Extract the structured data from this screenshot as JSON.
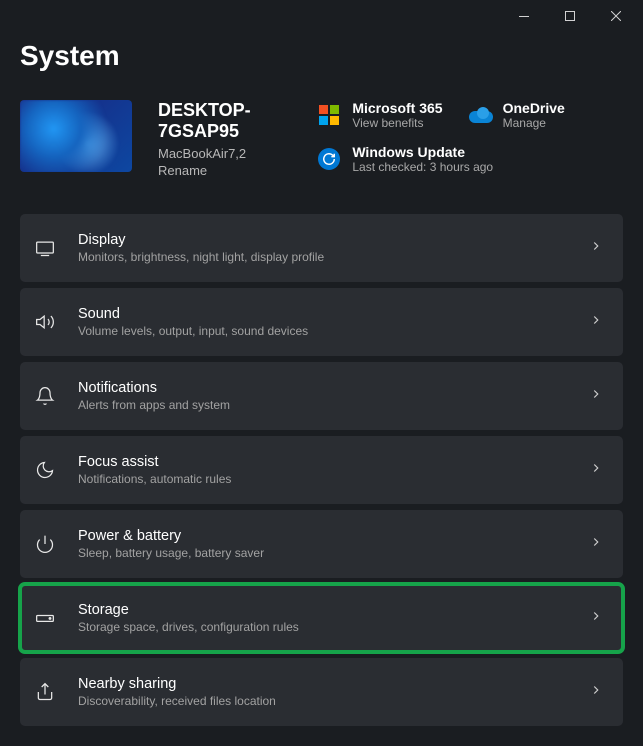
{
  "page": {
    "title": "System"
  },
  "pc": {
    "name": "DESKTOP-7GSAP95",
    "model": "MacBookAir7,2",
    "rename": "Rename"
  },
  "tiles": {
    "ms365": {
      "title": "Microsoft 365",
      "sub": "View benefits"
    },
    "onedrive": {
      "title": "OneDrive",
      "sub": "Manage"
    },
    "update": {
      "title": "Windows Update",
      "sub": "Last checked: 3 hours ago"
    }
  },
  "settings": [
    {
      "id": "display",
      "title": "Display",
      "sub": "Monitors, brightness, night light, display profile"
    },
    {
      "id": "sound",
      "title": "Sound",
      "sub": "Volume levels, output, input, sound devices"
    },
    {
      "id": "notifications",
      "title": "Notifications",
      "sub": "Alerts from apps and system"
    },
    {
      "id": "focus-assist",
      "title": "Focus assist",
      "sub": "Notifications, automatic rules"
    },
    {
      "id": "power-battery",
      "title": "Power & battery",
      "sub": "Sleep, battery usage, battery saver"
    },
    {
      "id": "storage",
      "title": "Storage",
      "sub": "Storage space, drives, configuration rules",
      "highlighted": true
    },
    {
      "id": "nearby-sharing",
      "title": "Nearby sharing",
      "sub": "Discoverability, received files location"
    }
  ]
}
